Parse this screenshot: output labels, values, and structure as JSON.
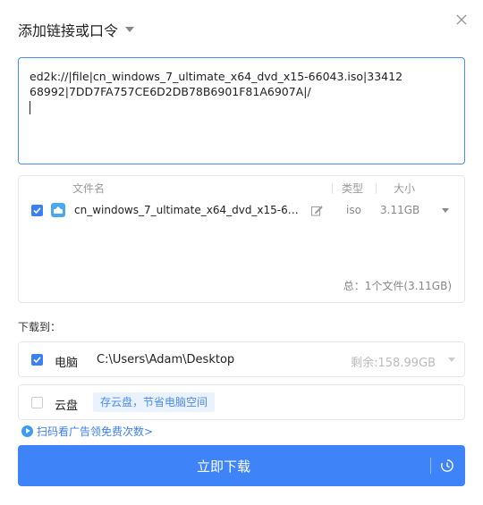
{
  "dialog": {
    "title": "添加链接或口令"
  },
  "link_input": {
    "value": "ed2k://|file|cn_windows_7_ultimate_x64_dvd_x15-66043.iso|3341268992|7DD7FA757CE6D2DB78B6901F81A6907A|/"
  },
  "file_list": {
    "headers": {
      "name": "文件名",
      "type": "类型",
      "size": "大小"
    },
    "files": [
      {
        "name": "cn_windows_7_ultimate_x64_dvd_x15-66043.iso",
        "type": "iso",
        "size": "3.11GB",
        "checked": true
      }
    ],
    "total": "总：1个文件(3.11GB)"
  },
  "download_to": {
    "label": "下载到：",
    "pc": {
      "name": "电脑",
      "path": "C:\\Users\\Adam\\Desktop",
      "free": "剩余:158.99GB",
      "checked": true
    },
    "cloud": {
      "name": "云盘",
      "tag": "存云盘，节省电脑空间",
      "checked": false
    }
  },
  "promo": {
    "text": "扫码看广告领免费次数>"
  },
  "actions": {
    "download_label": "立即下载"
  },
  "colors": {
    "accent": "#3e83f8",
    "border_focus": "#4a8bf5"
  }
}
